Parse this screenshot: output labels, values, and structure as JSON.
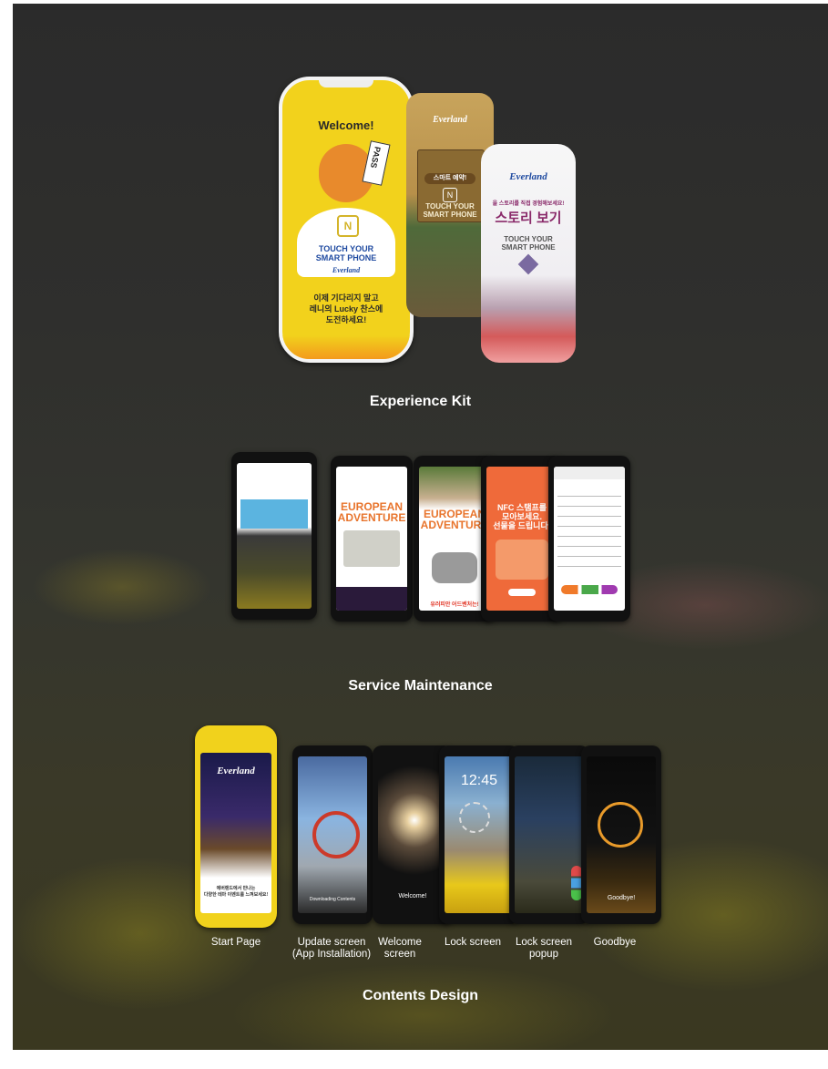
{
  "sections": {
    "experience_kit": "Experience Kit",
    "service_maintenance": "Service Maintenance",
    "contents_design": "Contents Design"
  },
  "kit": {
    "yellow_card": {
      "welcome": "Welcome!",
      "pass": "PASS",
      "touch": "TOUCH YOUR\nSMART PHONE",
      "logo": "Everland",
      "korean_line1": "이제 기다리지 말고",
      "korean_line2": "레니의 Lucky 찬스에",
      "korean_line3": "도전하세요!"
    },
    "wood_card": {
      "logo": "Everland",
      "button": "스마트 예약!",
      "touch": "TOUCH YOUR\nSMART PHONE"
    },
    "white_card": {
      "logo": "Everland",
      "tagline": "을 스토리를 직접 경험해보세요!",
      "title": "스토리 보기",
      "touch": "TOUCH YOUR\nSMART PHONE"
    }
  },
  "service": {
    "european": "EUROPEAN\nADVENTURE",
    "nfc": "NFC 스탬프를\n모아보세요.\n선물을 드립니다!",
    "european_footer": "유러피안 어드벤처는!"
  },
  "contents": {
    "captions": [
      "Start Page",
      "Update screen\n(App Installation)",
      "Welcome\nscreen",
      "Lock screen",
      "Lock screen\npopup",
      "Goodbye"
    ],
    "start_logo": "Everland",
    "start_text": "에버랜드에서 만나는\n다양한 테마 이벤트를 느껴보세요!",
    "update_text": "Downloading Contents",
    "welcome_text": "Welcome!",
    "lock_time": "12:45",
    "goodbye_text": "Goodbye!"
  }
}
